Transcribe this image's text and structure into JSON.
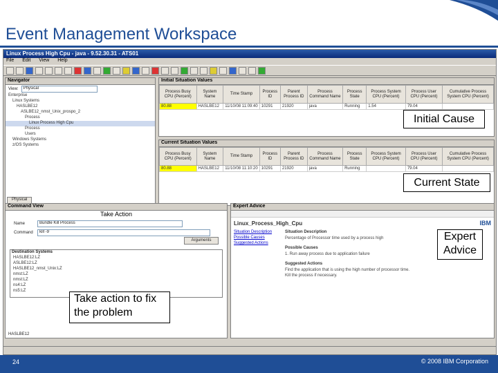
{
  "slide": {
    "title": "Event Management Workspace",
    "page_number": "24",
    "copyright": "© 2008 IBM Corporation"
  },
  "window": {
    "title": "Linux Process High Cpu - java - 9.52.30.31 - ATS01",
    "menu": [
      "File",
      "Edit",
      "View",
      "Help"
    ]
  },
  "navigator": {
    "header": "Navigator",
    "view_label": "View:",
    "view_value": "Physical",
    "tree": [
      "Enterprise",
      "Linux Systems",
      "HASLBE12",
      "ASLBE12_nmst_Unix_prospo_2",
      "Process",
      "Linux Process High Cpu",
      "Process",
      "Users",
      "Windows Systems",
      "z/OS Systems"
    ],
    "tab": "Physical"
  },
  "initial_values": {
    "header": "Initial Situation Values",
    "columns": [
      "Process Busy CPU (Percent)",
      "System Name",
      "Time Stamp",
      "Process ID",
      "Parent Process ID",
      "Process Command Name",
      "Process State",
      "Process System CPU (Percent)",
      "Process User CPU (Percent)",
      "Cumulative Process System CPU (Percent)"
    ],
    "row": [
      "80.88",
      "HASLBE12",
      "11/10/08 11:09:40",
      "10291",
      "21920",
      "java",
      "Running",
      "1.54",
      "79.04",
      ""
    ]
  },
  "current_values": {
    "header": "Current Situation Values",
    "columns": [
      "Process Busy CPU (Percent)",
      "System Name",
      "Time Stamp",
      "Process ID",
      "Parent Process ID",
      "Process Command Name",
      "Process State",
      "Process System CPU (Percent)",
      "Process User CPU (Percent)",
      "Cumulative Process System CPU (Percent)"
    ],
    "row": [
      "80.88",
      "HASLBE12",
      "11/10/08 11:10:20",
      "10291",
      "21920",
      "java",
      "Running",
      "",
      "79.04",
      ""
    ]
  },
  "command_view": {
    "header": "Command View",
    "take_action_title": "Take Action",
    "action_label": "Name",
    "action_value": "Bundle Kill Process",
    "command_label": "Command",
    "command_value": "kill -9",
    "arguments_button": "Arguments",
    "destination_header": "Destination Systems",
    "destinations": [
      "HASLBE12:LZ",
      "ASLBE12:LZ",
      "HASLBE12_nmst_Unix:LZ",
      "nmst:LZ",
      "nmst:LZ",
      "ns4:LZ",
      "ns5:LZ"
    ],
    "status": "HASLBE12"
  },
  "expert_advice": {
    "header": "Expert Advice",
    "situation_name": "Linux_Process_High_Cpu",
    "links": [
      "Situation Description",
      "Possible Causes",
      "Suggested Actions"
    ],
    "section_description": "Situation Description",
    "description_text": "Percentage of Processor time used by a process high",
    "section_causes": "Possible Causes",
    "causes_text": "1. Run away process due to application failure",
    "section_actions": "Suggested Actions",
    "actions_text_1": "Find the application that is using the high number of processor time.",
    "actions_text_2": "Kill the process if necessary.",
    "brand": "IBM"
  },
  "callouts": {
    "initial_cause": "Initial Cause",
    "current_state": "Current State",
    "expert_advice_line1": "Expert",
    "expert_advice_line2": "Advice",
    "take_action_line1": "Take action to fix",
    "take_action_line2": "the problem"
  },
  "colors": {
    "brand_blue": "#1f4e96",
    "highlight": "#ffff00",
    "titlebar": "#0a2a7a"
  }
}
